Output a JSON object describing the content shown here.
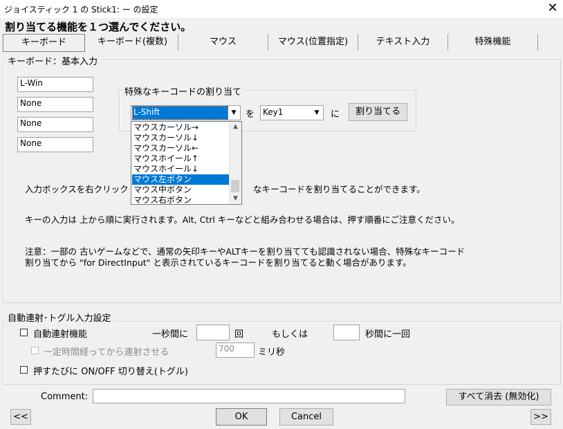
{
  "window": {
    "title": "ジョイスティック 1 の Stick1: ー の設定",
    "close": "✕"
  },
  "heading": "割り当てる機能を１つ選んでください。",
  "tabs": [
    "キーボード",
    "キーボード(複数)",
    "マウス",
    "マウス(位置指定)",
    "テキスト入力",
    "特殊機能"
  ],
  "keyboard_group": {
    "legend": "キーボード：基本入力",
    "inputs": [
      "L-Win",
      "None",
      "None",
      "None"
    ],
    "special": {
      "legend": "特殊なキーコードの割り当て",
      "key_combo": "L-Shift",
      "wo": "を",
      "target_combo": "Key1",
      "ni": "に",
      "assign_button": "割り当てる",
      "list": [
        "マウスカーソル→",
        "マウスカーソル↓",
        "マウスカーソル←",
        "マウスホイール↑",
        "マウスホイール↓",
        "マウス左ボタン",
        "マウス中ボタン",
        "マウス右ボタン"
      ],
      "selected_index": 5
    },
    "info1_a": "入力ボックスを右クリック",
    "info1_b": "なキーコードを割り当てることができます。",
    "info2": "キーの入力は 上から順に実行されます。Alt, Ctrl キーなどと組み合わせる場合は、押す順番にご注意ください。",
    "note1": "注意：一部の 古いゲームなどで、通常の矢印キーやALTキーを割り当てても認識されない場合、特殊なキーコード",
    "note2": "割り当てから \"for DirectInput\" と表示されているキーコードを割り当てると動く場合があります。"
  },
  "autofire": {
    "legend": "自動連射･トグル入力設定",
    "enable_label": "自動連射機能",
    "per_second": "一秒間に",
    "per_second_value": "",
    "times": "回",
    "or": "もしくは",
    "seconds_value": "",
    "per_seconds_once": "秒間に一回",
    "delay_label": "一定時間経ってから連射させる",
    "delay_value": "700",
    "ms": "ミリ秒",
    "toggle_label": "押すたびに ON/OFF 切り替え(トグル)"
  },
  "comment": {
    "label": "Comment:",
    "value": ""
  },
  "buttons": {
    "clear_all": "すべて消去 (無効化)",
    "prev": "<<",
    "ok": "OK",
    "cancel": "Cancel",
    "next": ">>"
  }
}
